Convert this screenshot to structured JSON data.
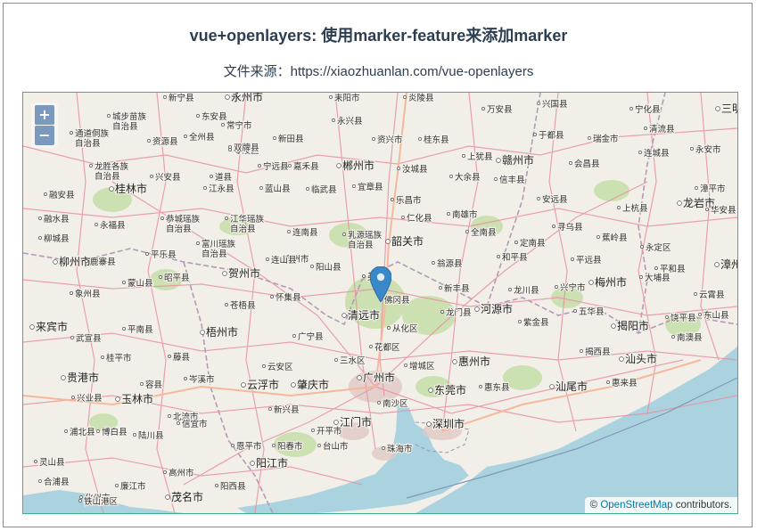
{
  "header": {
    "title": "vue+openlayers: 使用marker-feature来添加marker",
    "source": "文件来源：https://xiaozhuanlan.com/vue-openlayers"
  },
  "map": {
    "zoom_in_label": "+",
    "zoom_out_label": "−",
    "attribution_prefix": "©",
    "attribution_link": "OpenStreetMap",
    "attribution_suffix": " contributors.",
    "marker_color": "#3b88c9",
    "labels": [
      {
        "name": "新宁县"
      },
      {
        "name": "永州市"
      },
      {
        "name": "耒阳市"
      },
      {
        "name": "炎陵县"
      },
      {
        "name": "万安县"
      },
      {
        "name": "兴国县"
      },
      {
        "name": "宁化县"
      },
      {
        "name": "三明市"
      },
      {
        "name": "城步苗族自治县"
      },
      {
        "name": "东安县"
      },
      {
        "name": "常宁市"
      },
      {
        "name": "永兴县"
      },
      {
        "name": "零陵区"
      },
      {
        "name": "资兴市"
      },
      {
        "name": "桂东县"
      },
      {
        "name": "通道侗族自治县"
      },
      {
        "name": "全州县"
      },
      {
        "name": "新田县"
      },
      {
        "name": "于都县"
      },
      {
        "name": "瑞金市"
      },
      {
        "name": "清流县"
      },
      {
        "name": "资源县"
      },
      {
        "name": "双牌县"
      },
      {
        "name": "永安市"
      },
      {
        "name": "龙胜各族自治县"
      },
      {
        "name": "宁远县"
      },
      {
        "name": "嘉禾县"
      },
      {
        "name": "郴州市"
      },
      {
        "name": "上犹县"
      },
      {
        "name": "赣州市"
      },
      {
        "name": "连城县"
      },
      {
        "name": "汝城县"
      },
      {
        "name": "会昌县"
      },
      {
        "name": "兴安县"
      },
      {
        "name": "道县"
      },
      {
        "name": "大余县"
      },
      {
        "name": "信丰县"
      },
      {
        "name": "融安县"
      },
      {
        "name": "桂林市"
      },
      {
        "name": "江永县"
      },
      {
        "name": "蓝山县"
      },
      {
        "name": "临武县"
      },
      {
        "name": "宜章县"
      },
      {
        "name": "乐昌市"
      },
      {
        "name": "漳平市"
      },
      {
        "name": "安远县"
      },
      {
        "name": "融水县"
      },
      {
        "name": "恭城瑶族自治县"
      },
      {
        "name": "江华瑶族自治县"
      },
      {
        "name": "仁化县"
      },
      {
        "name": "南雄市"
      },
      {
        "name": "上杭县"
      },
      {
        "name": "龙岩市"
      },
      {
        "name": "华安县"
      },
      {
        "name": "永福县"
      },
      {
        "name": "连南县"
      },
      {
        "name": "乳源瑶族自治县"
      },
      {
        "name": "全南县"
      },
      {
        "name": "寻乌县"
      },
      {
        "name": "柳城县"
      },
      {
        "name": "富川瑶族自治县"
      },
      {
        "name": "连州市"
      },
      {
        "name": "韶关市"
      },
      {
        "name": "定南县"
      },
      {
        "name": "蕉岭县"
      },
      {
        "name": "永定区"
      },
      {
        "name": "柳州市"
      },
      {
        "name": "鹿寨县"
      },
      {
        "name": "平乐县"
      },
      {
        "name": "连山县"
      },
      {
        "name": "阳山县"
      },
      {
        "name": "翁源县"
      },
      {
        "name": "和平县"
      },
      {
        "name": "平远县"
      },
      {
        "name": "平和县"
      },
      {
        "name": "漳州市"
      },
      {
        "name": "贺州市"
      },
      {
        "name": "象州县"
      },
      {
        "name": "蒙山县"
      },
      {
        "name": "昭平县"
      },
      {
        "name": "新丰县"
      },
      {
        "name": "龙川县"
      },
      {
        "name": "兴宁市"
      },
      {
        "name": "梅州市"
      },
      {
        "name": "大埔县"
      },
      {
        "name": "云霄县"
      },
      {
        "name": "怀集县"
      },
      {
        "name": "苍梧县"
      },
      {
        "name": "佛冈县"
      },
      {
        "name": "龙门县"
      },
      {
        "name": "河源市"
      },
      {
        "name": "五华县"
      },
      {
        "name": "饶平县"
      },
      {
        "name": "东山县"
      },
      {
        "name": "来宾市"
      },
      {
        "name": "清远市"
      },
      {
        "name": "紫金县"
      },
      {
        "name": "武宣县"
      },
      {
        "name": "平南县"
      },
      {
        "name": "梧州市"
      },
      {
        "name": "广宁县"
      },
      {
        "name": "从化区"
      },
      {
        "name": "揭阳市"
      },
      {
        "name": "南澳县"
      },
      {
        "name": "花都区"
      },
      {
        "name": "桂平市"
      },
      {
        "name": "藤县"
      },
      {
        "name": "三水区"
      },
      {
        "name": "增城区"
      },
      {
        "name": "惠州市"
      },
      {
        "name": "揭西县"
      },
      {
        "name": "汕头市"
      },
      {
        "name": "云安区"
      },
      {
        "name": "岑溪市"
      },
      {
        "name": "贵港市"
      },
      {
        "name": "容县"
      },
      {
        "name": "云浮市"
      },
      {
        "name": "肇庆市"
      },
      {
        "name": "广州市"
      },
      {
        "name": "东莞市"
      },
      {
        "name": "惠东县"
      },
      {
        "name": "汕尾市"
      },
      {
        "name": "惠来县"
      },
      {
        "name": "兴业县"
      },
      {
        "name": "玉林市"
      },
      {
        "name": "南沙区"
      },
      {
        "name": "新兴县"
      },
      {
        "name": "北流市"
      },
      {
        "name": "信宜市"
      },
      {
        "name": "开平市"
      },
      {
        "name": "江门市"
      },
      {
        "name": "深圳市"
      },
      {
        "name": "浦北县"
      },
      {
        "name": "博白县"
      },
      {
        "name": "陆川县"
      },
      {
        "name": "台山市"
      },
      {
        "name": "珠海市"
      },
      {
        "name": "恩平市"
      },
      {
        "name": "阳春市"
      },
      {
        "name": "阳江市"
      },
      {
        "name": "灵山县"
      },
      {
        "name": "合浦县"
      },
      {
        "name": "廉江市"
      },
      {
        "name": "高州市"
      },
      {
        "name": "阳西县"
      },
      {
        "name": "化州市"
      },
      {
        "name": "铁山港区"
      },
      {
        "name": "茂名市"
      },
      {
        "name": "英"
      }
    ]
  }
}
